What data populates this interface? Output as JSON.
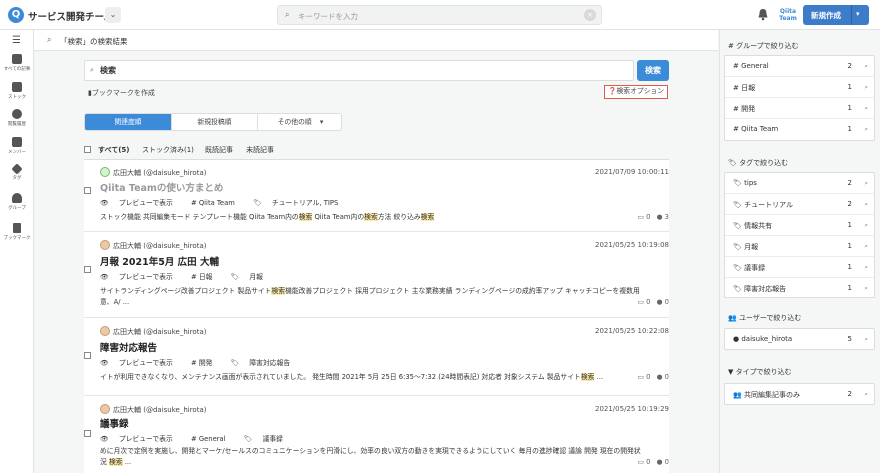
{
  "header": {
    "team_name": "サービス開発チーム",
    "team_dropdown": "⌄",
    "search_placeholder": "キーワードを入力",
    "qiita_team_logo": "Qiita Team",
    "new_post_label": "新規作成",
    "new_post_caret": "▾"
  },
  "leftnav": {
    "items": [
      {
        "label": "すべての記事",
        "icon": "inbox-icon"
      },
      {
        "label": "ストック",
        "icon": "stock-icon"
      },
      {
        "label": "閲覧履歴",
        "icon": "history-icon"
      },
      {
        "label": "メンバー",
        "icon": "member-icon"
      },
      {
        "label": "タグ",
        "icon": "tag-icon"
      },
      {
        "label": "グループ",
        "icon": "group-icon"
      },
      {
        "label": "ブックマーク",
        "icon": "bookmark-icon"
      }
    ]
  },
  "page": {
    "title": "「検索」の検索結果",
    "query": "検索",
    "search_button": "検索",
    "bookmark_label": "ブックマークを作成",
    "search_options_label": "検索オプション",
    "sort_tabs": [
      "関連度順",
      "新規投稿順",
      "その他の順"
    ],
    "sort_more_caret": "▾",
    "filters": [
      "すべて(5)",
      "ストック済み(1)",
      "既読記事",
      "未読記事"
    ]
  },
  "results": [
    {
      "author": "広田大輔 (@daisuke_hirota)",
      "date": "2021/07/09 10:00:11",
      "title": "Qiita Teamの使い方まとめ",
      "tags": [
        "プレビューで表示",
        "Qiita Team",
        "チュートリアル, TIPS"
      ],
      "snippet_parts": [
        "ストック機能 共同編集モード テンプレート機能 Qiita Team内の",
        "検索",
        " Qiita Team内の",
        "検索",
        "方法 絞り込み",
        "検索"
      ],
      "comments": "0",
      "likes": "3"
    },
    {
      "author": "広田大輔 (@daisuke_hirota)",
      "date": "2021/05/25 10:19:08",
      "title": "月報 2021年5月 広田 大輔",
      "tags": [
        "プレビューで表示",
        "日報",
        "月報"
      ],
      "snippet_parts": [
        "サイトランディングページ改善プロジェクト 製品サイト",
        "検索",
        "機能改善プロジェクト 採用プロジェクト 主な業務実績 ランディングページの成約率アップ キャッチコピーを複数用意、A/ ..."
      ],
      "comments": "0",
      "likes": "0"
    },
    {
      "author": "広田大輔 (@daisuke_hirota)",
      "date": "2021/05/25 10:22:08",
      "title": "障害対応報告",
      "tags": [
        "プレビューで表示",
        "開発",
        "障害対応報告"
      ],
      "snippet_parts": [
        "イトが利用できなくなり、メンテナンス画面が表示されていました。 発生時間 2021年 5月 25日 6:35〜7:32 (24時間表記) 対応者 対象システム 製品サイト",
        "検索",
        " ..."
      ],
      "comments": "0",
      "likes": "0"
    },
    {
      "author": "広田大輔 (@daisuke_hirota)",
      "date": "2021/05/25 10:19:29",
      "title": "議事録",
      "tags": [
        "プレビューで表示",
        "General",
        "議事録"
      ],
      "snippet_parts": [
        "めに月次で定例を実施し、開発とマーケ/セールスのコミュニケーションを円滑にし、効率の良い双方の動きを実現できるようにしていく 毎月の進捗確認 議論 開発 現在の開発状況 ",
        "検索",
        " ..."
      ],
      "comments": "0",
      "likes": "0"
    }
  ],
  "sidebar": {
    "group_heading": "グループで絞り込む",
    "groups": [
      {
        "name": "General",
        "count": "2"
      },
      {
        "name": "日報",
        "count": "1"
      },
      {
        "name": "開発",
        "count": "1"
      },
      {
        "name": "Qiita Team",
        "count": "1"
      }
    ],
    "tag_heading": "タグで絞り込む",
    "tags": [
      {
        "name": "tips",
        "count": "2"
      },
      {
        "name": "チュートリアル",
        "count": "2"
      },
      {
        "name": "情報共有",
        "count": "1"
      },
      {
        "name": "月報",
        "count": "1"
      },
      {
        "name": "議事録",
        "count": "1"
      },
      {
        "name": "障害対応報告",
        "count": "1"
      }
    ],
    "user_heading": "ユーザーで絞り込む",
    "users": [
      {
        "name": "daisuke_hirota",
        "count": "5"
      }
    ],
    "type_heading": "タイプで絞り込む",
    "types": [
      {
        "name": "共同編集記事のみ",
        "count": "2"
      }
    ]
  },
  "colors": {
    "accent": "#3b8bd9",
    "highlight": "#fbe9a3",
    "option_border": "#e05b4b"
  }
}
